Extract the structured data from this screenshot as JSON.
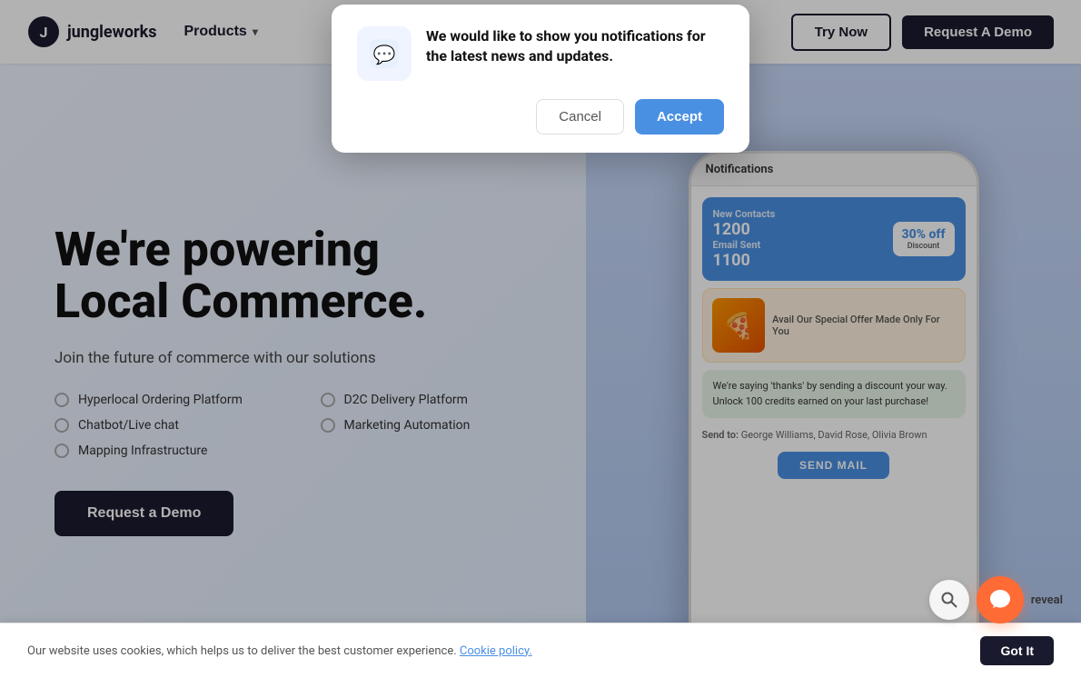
{
  "navbar": {
    "logo_text": "jungleworks",
    "products_label": "Products",
    "try_now_label": "Try Now",
    "request_demo_label": "Request A Demo"
  },
  "hero": {
    "heading_line1": "We're powering",
    "heading_line2": "Local Commerce.",
    "subtext": "Join the future of commerce with our solutions",
    "radio_options": [
      {
        "label": "Hyperlocal Ordering Platform"
      },
      {
        "label": "D2C Delivery Platform"
      },
      {
        "label": "Chatbot/Live chat"
      },
      {
        "label": "Marketing Automation"
      },
      {
        "label": "Mapping Infrastructure"
      }
    ],
    "cta_label": "Request a Demo"
  },
  "phone_mockup": {
    "header": "Notifications",
    "contacts_label": "New Contacts",
    "contacts_value": "1200",
    "email_label": "Email Sent",
    "email_value": "1100",
    "discount_text": "30% off",
    "food_offer_text": "Avail Our Special Offer Made Only For You",
    "chat_text": "We're saying 'thanks' by sending a discount your way. Unlock 100 credits earned on your last purchase!",
    "send_to": "George Williams, David Rose, Olivia Brown",
    "send_btn": "SEND MAIL"
  },
  "notification_popup": {
    "title": "We would like to show you notifications for the latest news and updates.",
    "cancel_label": "Cancel",
    "accept_label": "Accept"
  },
  "cookie_banner": {
    "text": "Our website uses cookies, which helps us to deliver the best customer experience.",
    "policy_link": "Cookie policy.",
    "got_it_label": "Got It"
  },
  "chat_widget": {
    "reveal_label": "reveal"
  }
}
